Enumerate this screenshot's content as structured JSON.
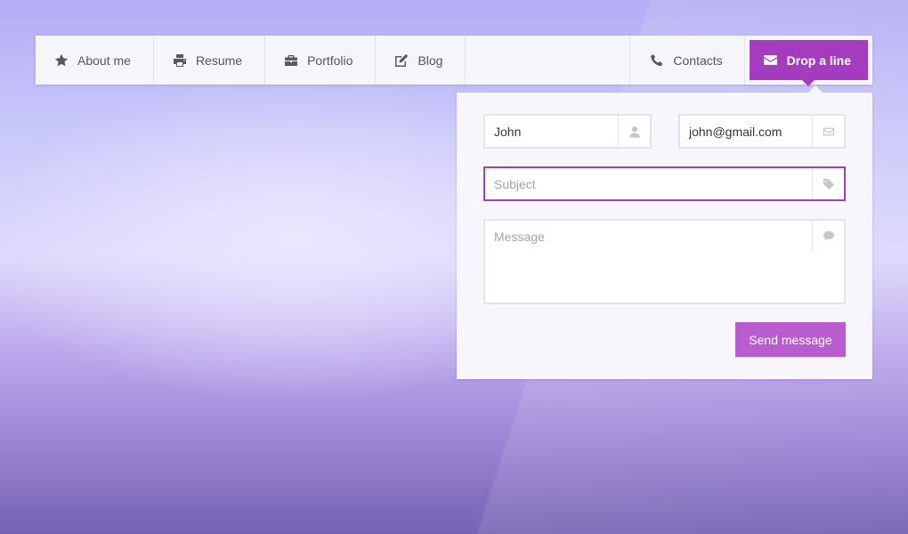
{
  "nav": {
    "items": [
      {
        "label": "About me",
        "icon": "star-icon"
      },
      {
        "label": "Resume",
        "icon": "printer-icon"
      },
      {
        "label": "Portfolio",
        "icon": "briefcase-icon"
      },
      {
        "label": "Blog",
        "icon": "edit-icon"
      }
    ],
    "contacts": {
      "label": "Contacts",
      "icon": "phone-icon"
    },
    "drop": {
      "label": "Drop a line",
      "icon": "envelope-icon"
    }
  },
  "form": {
    "name": {
      "value": "John",
      "icon": "user-icon"
    },
    "email": {
      "value": "john@gmail.com",
      "icon": "envelope-outline-icon"
    },
    "subject": {
      "value": "",
      "placeholder": "Subject",
      "icon": "tag-icon"
    },
    "message": {
      "value": "",
      "placeholder": "Message",
      "icon": "comment-icon"
    },
    "submit_label": "Send message"
  },
  "colors": {
    "accent": "#a53bbf",
    "button": "#b85ccf",
    "panel": "#f7f6fc"
  }
}
